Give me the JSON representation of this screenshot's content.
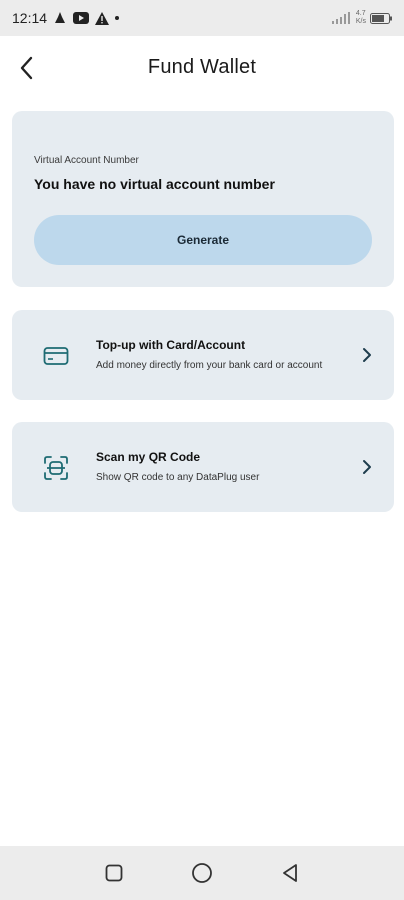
{
  "status_bar": {
    "time": "12:14",
    "net_speed_top": "4.7",
    "net_speed_bottom": "K/s"
  },
  "header": {
    "title": "Fund Wallet"
  },
  "virtual_account": {
    "label": "Virtual Account Number",
    "value": "You have no virtual account number",
    "button_label": "Generate"
  },
  "options": [
    {
      "title": "Top-up with Card/Account",
      "subtitle": "Add money directly from your bank card or account",
      "icon": "card-icon"
    },
    {
      "title": "Scan my QR Code",
      "subtitle": "Show QR code to any DataPlug user",
      "icon": "qr-scan-icon"
    }
  ],
  "colors": {
    "card_bg": "#e6ecf1",
    "button_bg": "#bdd8ec",
    "icon_accent": "#1e6b73"
  }
}
